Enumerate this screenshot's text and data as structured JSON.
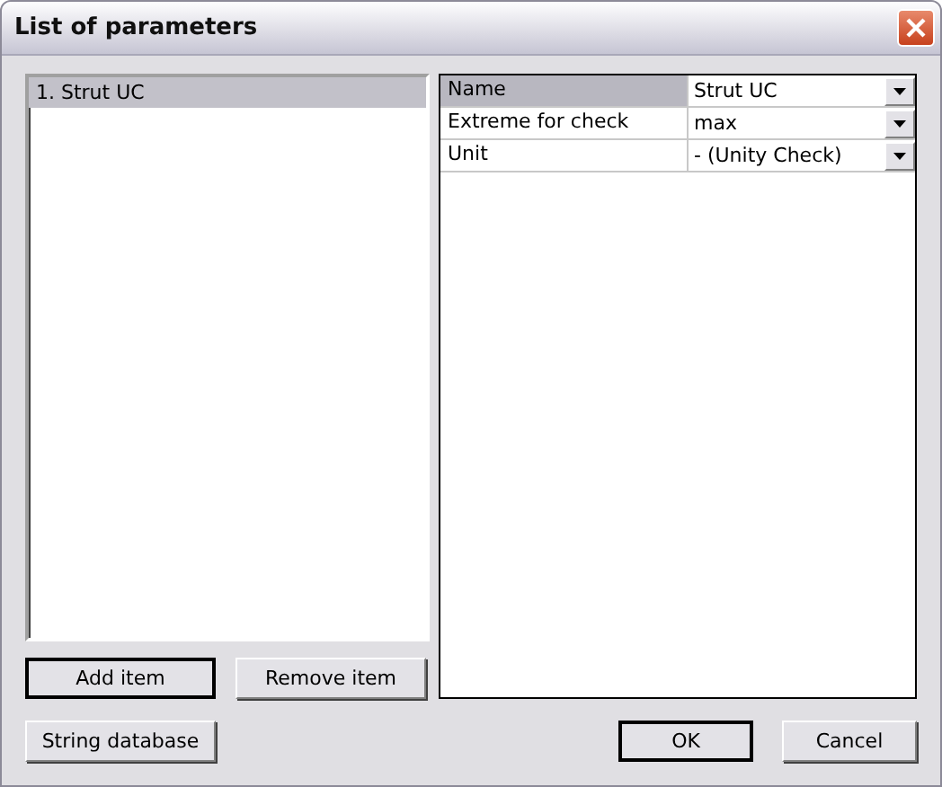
{
  "window": {
    "title": "List of parameters"
  },
  "items": [
    {
      "label": "1. Strut UC",
      "selected": true
    }
  ],
  "properties": [
    {
      "name": "Name",
      "value": "Strut UC",
      "selected": true
    },
    {
      "name": "Extreme for check",
      "value": "max",
      "selected": false
    },
    {
      "name": "Unit",
      "value": "- (Unity Check)",
      "selected": false
    }
  ],
  "list_buttons": [
    {
      "label": "Add item",
      "default": true
    },
    {
      "label": "Remove item",
      "default": false
    }
  ],
  "footer_buttons": [
    {
      "label": "String database",
      "default": false,
      "kind": "left"
    },
    {
      "label": "OK",
      "default": true,
      "kind": "right"
    },
    {
      "label": "Cancel",
      "default": false,
      "kind": "right"
    }
  ]
}
